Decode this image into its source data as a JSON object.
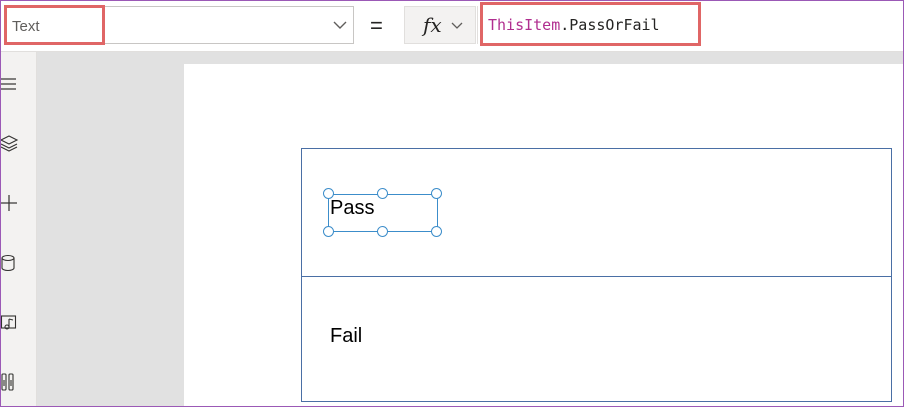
{
  "formula_bar": {
    "property": "Text",
    "equals": "=",
    "fx": "fx",
    "formula_object": "ThisItem",
    "formula_rest": ".PassOrFail"
  },
  "left_rail": {
    "icons": [
      "menu-icon",
      "layers-icon",
      "add-icon",
      "data-icon",
      "media-icon",
      "tools-icon"
    ]
  },
  "gallery": {
    "items": [
      "Pass",
      "Fail"
    ]
  },
  "colors": {
    "highlight": "#e06666",
    "formula_keyword": "#b02e8f",
    "selection": "#3c8dca"
  }
}
